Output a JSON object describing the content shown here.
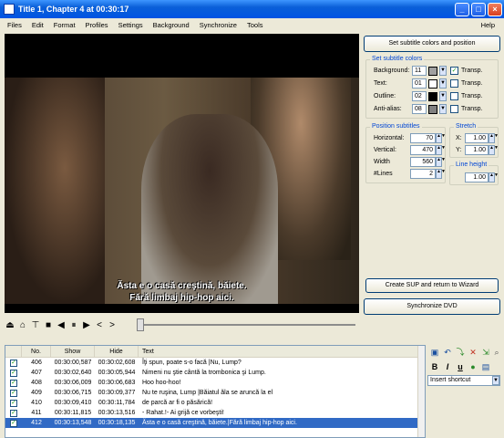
{
  "window": {
    "title": "Title 1, Chapter 4 at 00:30:17"
  },
  "menu": [
    "Files",
    "Edit",
    "Format",
    "Profiles",
    "Settings",
    "Background",
    "Synchronize",
    "Tools"
  ],
  "menu_help": "Help",
  "subtitle_line1": "Ăsta e o casă creştină, băiete.",
  "subtitle_line2": "Fără limbaj hip-hop aici.",
  "panel": {
    "set_colors_button": "Set subtitle colors and position",
    "colors_group": "Set subtitle colors",
    "background": {
      "label": "Background:",
      "value": "11",
      "color": "#a0a0a0",
      "transp_label": "Transp.",
      "transp": true
    },
    "text": {
      "label": "Text:",
      "value": "01",
      "color": "#ffffff",
      "transp_label": "Transp.",
      "transp": false
    },
    "outline": {
      "label": "Outline:",
      "value": "02",
      "color": "#000000",
      "transp_label": "Transp.",
      "transp": false
    },
    "antialias": {
      "label": "Anti-alias:",
      "value": "08",
      "color": "#808080",
      "transp_label": "Transp.",
      "transp": false
    },
    "position_group": "Position subtitles",
    "horizontal": {
      "label": "Horizontal:",
      "value": "70"
    },
    "vertical": {
      "label": "Vertical:",
      "value": "470"
    },
    "width": {
      "label": "Width",
      "value": "560"
    },
    "lines": {
      "label": "#Lines",
      "value": "2"
    },
    "stretch_group": "Stretch",
    "stretch_x": {
      "label": "X:",
      "value": "1.00"
    },
    "stretch_y": {
      "label": "Y:",
      "value": "1.00"
    },
    "line_height_group": "Line height",
    "line_height": "1.00",
    "create_sup_button": "Create SUP and return to Wizard",
    "sync_dvd_button": "Synchronize DVD"
  },
  "table": {
    "headers": [
      "No.",
      "Show",
      "Hide",
      "Text"
    ],
    "rows": [
      {
        "no": "406",
        "show": "00:30:00,587",
        "hide": "00:30:02,608",
        "text": "Îţi spun, poate s-o facă |Nu, Lump?",
        "selected": false
      },
      {
        "no": "407",
        "show": "00:30:02,640",
        "hide": "00:30:05,944",
        "text": "Nimeni nu ştie cântă la trombonica şi Lump.",
        "selected": false
      },
      {
        "no": "408",
        "show": "00:30:06,009",
        "hide": "00:30:06,683",
        "text": "Hoo hoo-hoo!",
        "selected": false
      },
      {
        "no": "409",
        "show": "00:30:06,715",
        "hide": "00:30:09,377",
        "text": "Nu te ruşina, Lump |Băiatul ăla se aruncă la el",
        "selected": false
      },
      {
        "no": "410",
        "show": "00:30:09,410",
        "hide": "00:30:11,784",
        "text": "de parcă ar fi o păsărică!",
        "selected": false
      },
      {
        "no": "411",
        "show": "00:30:11,815",
        "hide": "00:30:13,516",
        "text": "- Rahat.!- Ai grijă ce vorbeşti!",
        "selected": false
      },
      {
        "no": "412",
        "show": "00:30:13,548",
        "hide": "00:30:18,135",
        "text": "Ăsta e o casă creştină, băiete.|Fără limbaj hip-hop aici.",
        "selected": true
      }
    ]
  },
  "tools": {
    "shortcut_placeholder": "Insert shortcut"
  }
}
